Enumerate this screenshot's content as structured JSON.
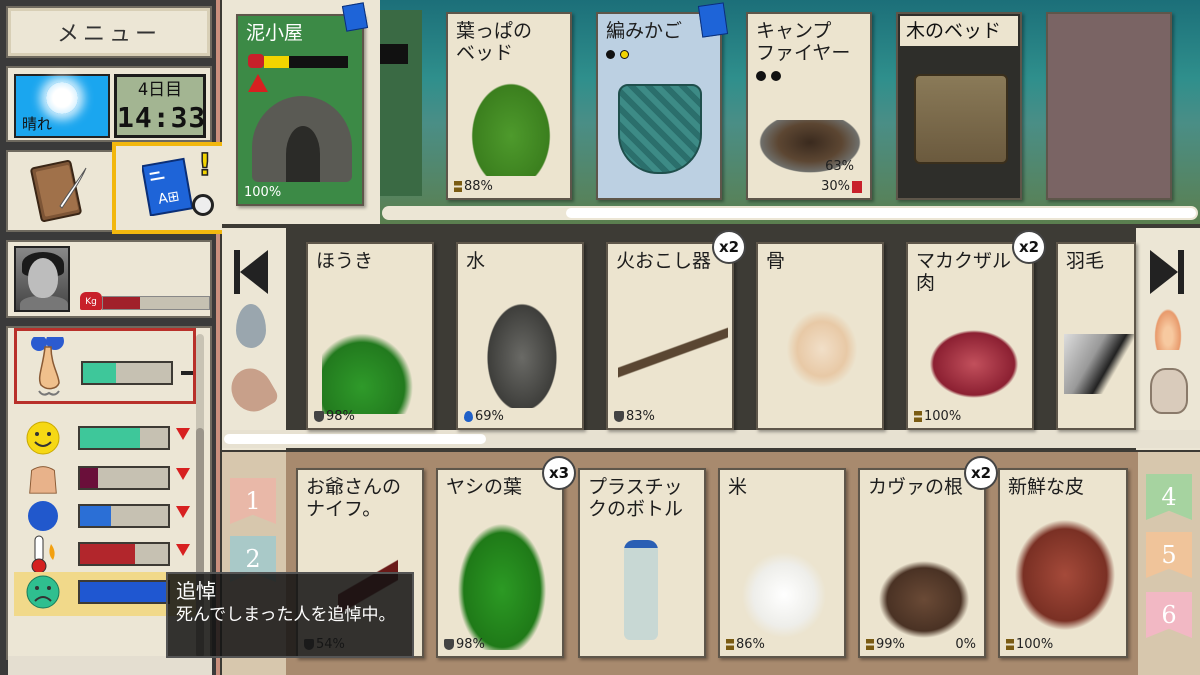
{
  "sidebar": {
    "menu_label": "メニュー",
    "weather": {
      "label": "晴れ",
      "icon": "sun-icon"
    },
    "clock": {
      "day": "4日目",
      "time": "14:33"
    },
    "tools": [
      {
        "icon": "journal-icon"
      },
      {
        "icon": "blueprint-icon"
      }
    ],
    "weight": {
      "level": 0.35
    },
    "stats": [
      {
        "icon": "nose-icon",
        "level": 0.38,
        "trend": "steady",
        "color": "#3ec79a"
      },
      {
        "icon": "smile-icon",
        "level": 0.68,
        "trend": "down",
        "color": "#3ec79a"
      },
      {
        "icon": "body-icon",
        "level": 0.2,
        "trend": "down",
        "color": "#6a0f3a"
      },
      {
        "icon": "water-icon",
        "level": 0.35,
        "trend": "down",
        "color": "#2b6fd6"
      },
      {
        "icon": "thermometer-icon",
        "level": 0.62,
        "trend": "down",
        "color": "#b2262c"
      },
      {
        "icon": "sad-face-icon",
        "level": 1.0,
        "trend": "none",
        "color": "#1f57d1"
      }
    ]
  },
  "locations": [
    {
      "title": "泥小屋",
      "status": "100%",
      "alert": "!"
    },
    {
      "title": "葉っぱの\nベッド",
      "status": "88%"
    },
    {
      "title": "編みかご",
      "status": ""
    },
    {
      "title": "キャンプ\nファイヤー",
      "status": "30%",
      "status2": "63%"
    },
    {
      "title": "木のベッド",
      "status": ""
    }
  ],
  "inventory": [
    {
      "title": "ほうき",
      "status": "98%"
    },
    {
      "title": "水",
      "status": "69%"
    },
    {
      "title": "火おこし器",
      "status": "83%",
      "count": "x2"
    },
    {
      "title": "骨",
      "status": ""
    },
    {
      "title": "マカクザル\n肉",
      "status": "100%",
      "count": "x2"
    },
    {
      "title": "羽毛",
      "status": ""
    }
  ],
  "storage": [
    {
      "title": "お爺さんの\nナイフ。",
      "status": "54%"
    },
    {
      "title": "ヤシの葉",
      "status": "98%",
      "count": "x3"
    },
    {
      "title": "プラスチッ\nクのボトル",
      "status": ""
    },
    {
      "title": "米",
      "status": "86%"
    },
    {
      "title": "カヴァの根",
      "status": "99%",
      "status2": "0%",
      "count": "x2"
    },
    {
      "title": "新鮮な皮",
      "status": "100%"
    }
  ],
  "tabs_left": [
    "1",
    "2"
  ],
  "tabs_right": [
    "4",
    "5",
    "6"
  ],
  "tooltip": {
    "title": "追悼",
    "body": "死んでしまった人を追悼中。"
  },
  "colors": {
    "accent": "#f2b70e",
    "card": "#ece4cf",
    "alert": "#d72020"
  }
}
